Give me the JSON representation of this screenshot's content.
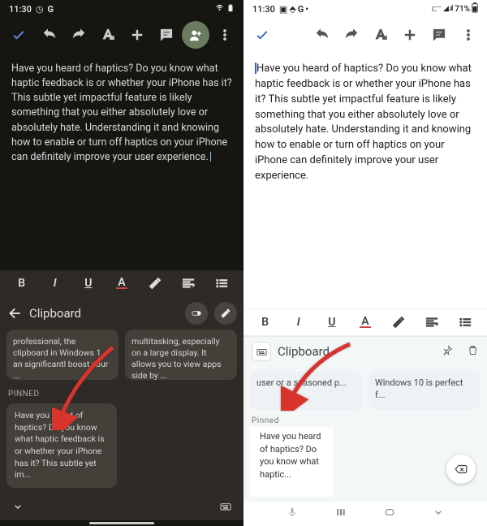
{
  "left": {
    "status": {
      "time": "11:30",
      "icons": [
        "①",
        "G"
      ],
      "right_wifi": "▾",
      "right_batt": "■"
    },
    "doc_text": "Have you heard of haptics? Do you know what haptic feedback is or whether your iPhone has it? This subtle yet impactful feature is likely something that you either absolutely love or absolutely hate. Understanding it and knowing how to enable or turn off haptics on your iPhone can definitely improve your user experience.",
    "format": {
      "bold": "B",
      "italic": "I",
      "underline": "U",
      "color": "A"
    },
    "clipboard": {
      "title": "Clipboard",
      "cards": [
        "professional, the clipboard in Windows 1   an significantl   boost your ...",
        "multitasking, especially on a large display. It allows you to view apps side by ..."
      ],
      "pinned_label": "PINNED",
      "pinned_text": "Have you heard of haptics? Do you know what haptic feedback is or whether your iPhone has it? This subtle yet im..."
    }
  },
  "right": {
    "status": {
      "time": "11:30",
      "icons": [
        "▣",
        "⬙",
        "G",
        "·"
      ],
      "sig": "▯◢ .ıl",
      "batt": "71%"
    },
    "doc_text": "Have you heard of haptics? Do you know what haptic feedback is or whether your iPhone has it? This subtle yet impactful feature is likely something that you either absolutely love or absolutely hate. Understanding it and knowing how to enable or turn off haptics on your iPhone can definitely improve your user experience.",
    "format": {
      "bold": "B",
      "italic": "I",
      "underline": "U",
      "color": "A"
    },
    "clipboard": {
      "title": "Clipboard",
      "cards": [
        "user or a seasoned p...",
        "Windows 10 is perfect f..."
      ],
      "pinned_label": "Pinned",
      "pinned_text": "Have you heard of haptics? Do you know what haptic..."
    }
  },
  "arrow_color": "#d8342d"
}
